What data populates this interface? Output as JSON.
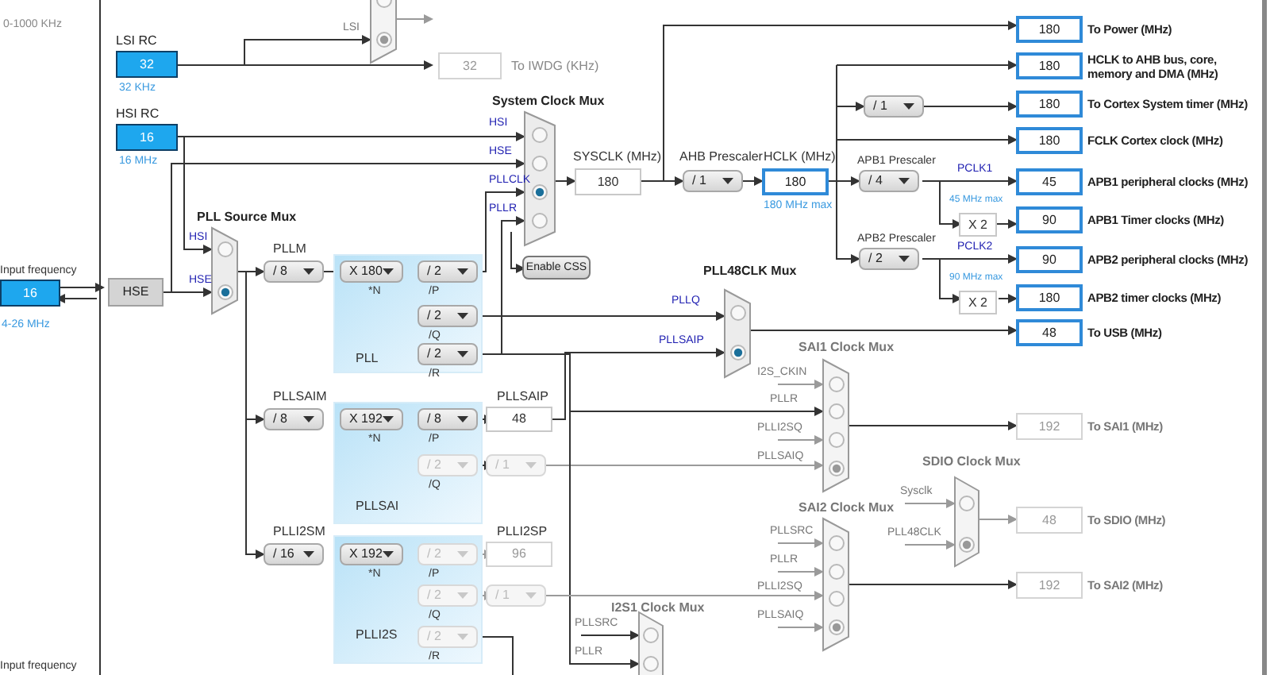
{
  "lse": {
    "range": "0-1000 KHz"
  },
  "sources": [
    {
      "title": "LSI RC",
      "value": "32",
      "range": "32 KHz"
    },
    {
      "title": "HSI RC",
      "value": "16",
      "range": "16 MHz"
    }
  ],
  "hse": {
    "label": "Input frequency",
    "value": "16",
    "range": "4-26 MHz",
    "name": "HSE"
  },
  "bottom_label": "Input frequency",
  "iwdg": {
    "value": "32",
    "label": "To IWDG (KHz)"
  },
  "muxes": [
    {
      "disabled": true,
      "inputs": [
        {
          "selected": false
        },
        {
          "label": "LSI",
          "selected": true
        }
      ]
    },
    {
      "title": "System Clock Mux",
      "disabled": false,
      "inputs": [
        {
          "label": "HSI",
          "selected": false
        },
        {
          "label": "HSE",
          "selected": false
        },
        {
          "label": "PLLCLK",
          "selected": true
        },
        {
          "label": "PLLR",
          "selected": false
        }
      ]
    },
    {
      "title": "PLL Source Mux",
      "disabled": false,
      "inputs": [
        {
          "label": "HSI",
          "selected": false
        },
        {
          "label": "HSE",
          "selected": true
        }
      ]
    },
    {
      "title": "PLL48CLK Mux",
      "disabled": false,
      "inputs": [
        {
          "label": "PLLQ",
          "selected": false
        },
        {
          "label": "PLLSAIP",
          "selected": true
        }
      ]
    },
    {
      "title": "SAI1 Clock Mux",
      "disabled": true,
      "inputs": [
        {
          "label": "I2S_CKIN",
          "selected": false
        },
        {
          "label": "PLLR",
          "selected": false
        },
        {
          "label": "PLLI2SQ",
          "selected": false
        },
        {
          "label": "PLLSAIQ",
          "selected": true
        }
      ]
    },
    {
      "title": "SDIO Clock Mux",
      "disabled": true,
      "inputs": [
        {
          "label": "Sysclk",
          "selected": false
        },
        {
          "label": "PLL48CLK",
          "selected": true
        }
      ]
    },
    {
      "title": "SAI2 Clock Mux",
      "disabled": true,
      "inputs": [
        {
          "label": "PLLSRC",
          "selected": false
        },
        {
          "label": "PLLR",
          "selected": false
        },
        {
          "label": "PLLI2SQ",
          "selected": false
        },
        {
          "label": "PLLSAIQ",
          "selected": true
        }
      ]
    },
    {
      "title": "I2S1 Clock Mux",
      "disabled": true,
      "inputs": [
        {
          "label": "PLLSRC",
          "selected": false
        },
        {
          "label": "PLLR",
          "selected": false
        }
      ]
    }
  ],
  "css_button": "Enable CSS",
  "plls": [
    {
      "name": "PLL",
      "predivider": {
        "title": "PLLM",
        "value": "/ 8",
        "disabled": false
      },
      "multiplier": {
        "value": "X 180",
        "tag": "*N",
        "disabled": false
      },
      "outputs": [
        {
          "value": "/ 2",
          "tag": "/P",
          "disabled": false
        },
        {
          "value": "/ 2",
          "tag": "/Q",
          "disabled": false
        },
        {
          "value": "/ 2",
          "tag": "/R",
          "disabled": false
        }
      ]
    },
    {
      "name": "PLLSAI",
      "predivider": {
        "title": "PLLSAIM",
        "value": "/ 8",
        "disabled": false
      },
      "multiplier": {
        "value": "X 192",
        "tag": "*N",
        "disabled": false
      },
      "outputs": [
        {
          "value": "/ 8",
          "tag": "/P",
          "disabled": false
        },
        {
          "value": "/ 2",
          "tag": "/Q",
          "disabled": true
        }
      ],
      "p_output": {
        "title": "PLLSAIP",
        "value": "48",
        "disabled": false
      },
      "q_divider": {
        "value": "/ 1",
        "disabled": true
      }
    },
    {
      "name": "PLLI2S",
      "predivider": {
        "title": "PLLI2SM",
        "value": "/ 16",
        "disabled": false
      },
      "multiplier": {
        "value": "X 192",
        "tag": "*N",
        "disabled": false
      },
      "outputs": [
        {
          "value": "/ 2",
          "tag": "/P",
          "disabled": true
        },
        {
          "value": "/ 2",
          "tag": "/Q",
          "disabled": true
        },
        {
          "value": "/ 2",
          "tag": "/R",
          "disabled": true
        }
      ],
      "p_output": {
        "title": "PLLI2SP",
        "value": "96",
        "disabled": true
      },
      "q_divider": {
        "value": "/ 1",
        "disabled": true
      }
    }
  ],
  "sysclk": {
    "label": "SYSCLK (MHz)",
    "value": "180"
  },
  "ahb": {
    "title": "AHB Prescaler",
    "value": "/ 1"
  },
  "hclk": {
    "label": "HCLK (MHz)",
    "value": "180",
    "max": "180 MHz max"
  },
  "cortex_divider": {
    "value": "/ 1"
  },
  "apb": [
    {
      "title": "APB1 Prescaler",
      "value": "/ 4",
      "clock": "PCLK1",
      "max": "45 MHz max",
      "multiplier": "X 2"
    },
    {
      "title": "APB2 Prescaler",
      "value": "/ 2",
      "clock": "PCLK2",
      "max": "90 MHz max",
      "multiplier": "X 2"
    }
  ],
  "outputs": [
    {
      "value": "180",
      "label": "To Power (MHz)",
      "active": true
    },
    {
      "value": "180",
      "label": "HCLK to AHB bus, core, memory and DMA (MHz)",
      "active": true
    },
    {
      "value": "180",
      "label": "To Cortex System timer (MHz)",
      "active": true
    },
    {
      "value": "180",
      "label": "FCLK Cortex clock (MHz)",
      "active": true
    },
    {
      "value": "45",
      "label": "APB1 peripheral clocks (MHz)",
      "active": true
    },
    {
      "value": "90",
      "label": "APB1 Timer clocks (MHz)",
      "active": true
    },
    {
      "value": "90",
      "label": "APB2 peripheral clocks (MHz)",
      "active": true
    },
    {
      "value": "180",
      "label": "APB2 timer clocks (MHz)",
      "active": true
    },
    {
      "value": "48",
      "label": "To USB (MHz)",
      "active": true
    },
    {
      "value": "192",
      "label": "To SAI1 (MHz)",
      "active": false
    },
    {
      "value": "48",
      "label": "To SDIO (MHz)",
      "active": false
    },
    {
      "value": "192",
      "label": "To SAI2 (MHz)",
      "active": false
    }
  ]
}
